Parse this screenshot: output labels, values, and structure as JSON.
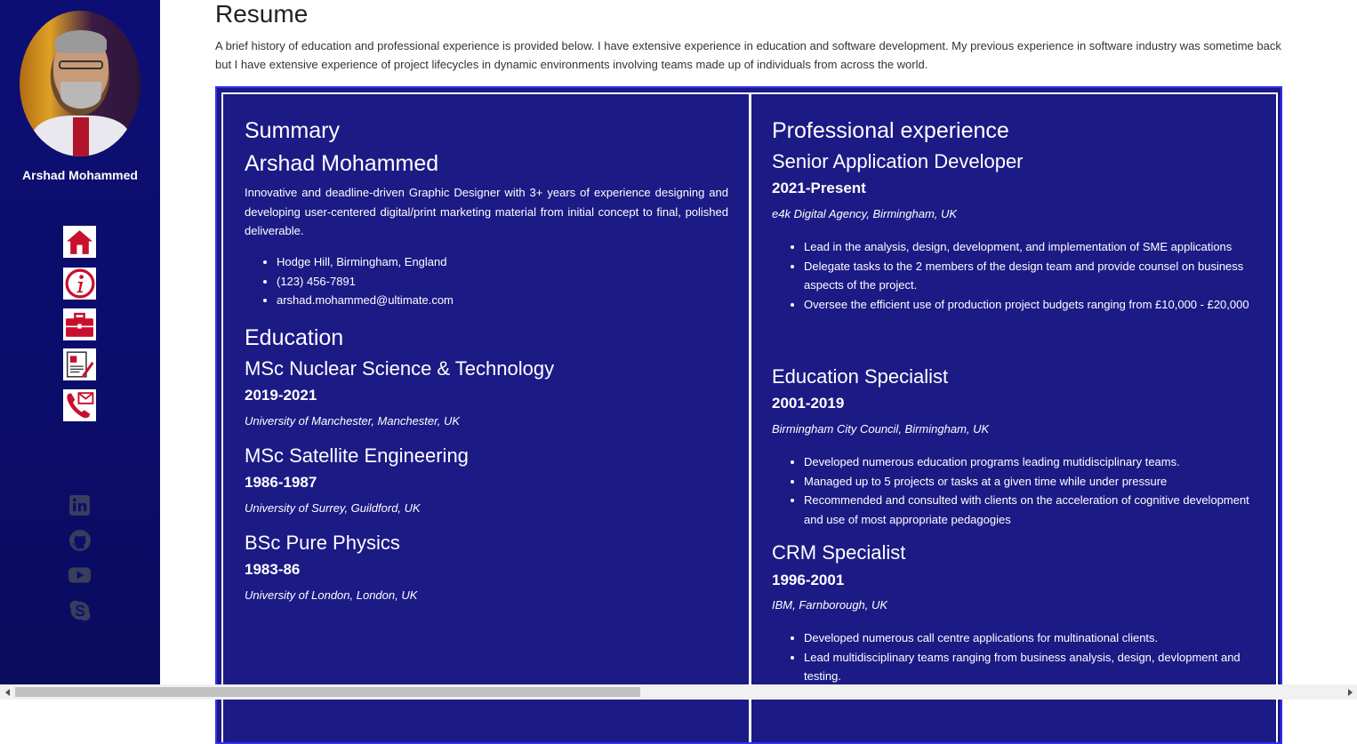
{
  "sidebar": {
    "owner_name": "Arshad Mohammed",
    "nav_icons": [
      "home-icon",
      "info-icon",
      "briefcase-icon",
      "resume-icon",
      "contact-icon"
    ],
    "social_icons": [
      "linkedin-icon",
      "github-icon",
      "youtube-icon",
      "skype-icon"
    ],
    "colors": {
      "background": "#0c0e74",
      "icon_red": "#c8102e",
      "social_gray": "#3a3d5c"
    }
  },
  "main": {
    "title": "Resume",
    "intro": "A brief history of education and professional experience is provided below. I have extensive experience in education and software development. My previous experience in software industry was sometime back but I have extensive experience of project lifecycles in dynamic environments involving teams made up of individuals from across the world."
  },
  "summary": {
    "heading": "Summary",
    "name": "Arshad Mohammed",
    "description": "Innovative and deadline-driven Graphic Designer with 3+ years of experience designing and developing user-centered digital/print marketing material from initial concept to final, polished deliverable.",
    "contact": [
      "Hodge Hill, Birmingham, England",
      "(123) 456-7891",
      "arshad.mohammed@ultimate.com"
    ]
  },
  "education": {
    "heading": "Education",
    "items": [
      {
        "degree": "MSc Nuclear Science & Technology",
        "years": "2019-2021",
        "institution": "University of Manchester, Manchester, UK"
      },
      {
        "degree": "MSc Satellite Engineering",
        "years": "1986-1987",
        "institution": "University of Surrey, Guildford, UK"
      },
      {
        "degree": "BSc Pure Physics",
        "years": "1983-86",
        "institution": "University of London, London, UK"
      }
    ]
  },
  "experience": {
    "heading": "Professional experience",
    "items": [
      {
        "role": "Senior Application Developer",
        "years": "2021-Present",
        "company": "e4k Digital Agency, Birmingham, UK",
        "points": [
          "Lead in the analysis, design, development, and implementation of SME applications",
          "Delegate tasks to the 2 members of the design team and provide counsel on business aspects of the project.",
          "Oversee the efficient use of production project budgets ranging from £10,000 - £20,000"
        ]
      },
      {
        "role": "Education Specialist",
        "years": "2001-2019",
        "company": "Birmingham City Council, Birmingham, UK",
        "points": [
          "Developed numerous education programs leading mutidisciplinary teams.",
          "Managed up to 5 projects or tasks at a given time while under pressure",
          "Recommended and consulted with clients on the acceleration of cognitive development and use of most appropriate pedagogies"
        ]
      },
      {
        "role": "CRM Specialist",
        "years": "1996-2001",
        "company": "IBM, Farnborough, UK",
        "points": [
          "Developed numerous call centre applications for multinational clients.",
          "Lead multidisciplinary teams ranging from business analysis, design, devlopment and testing."
        ]
      }
    ]
  },
  "theme": {
    "panel_bg": "#1c1a85",
    "panel_border": "#3430f0",
    "text": "#ffffff"
  }
}
